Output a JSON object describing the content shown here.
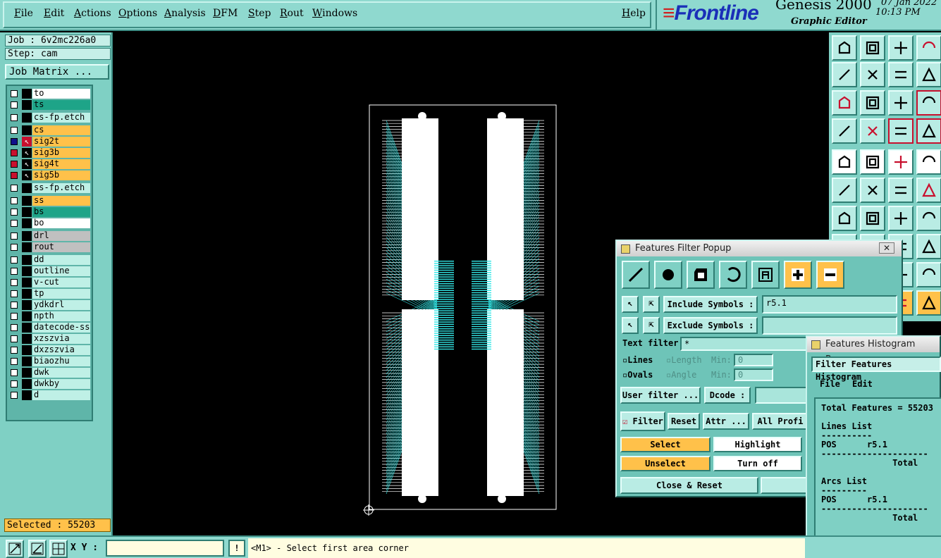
{
  "menu": {
    "items": [
      "File",
      "Edit",
      "Actions",
      "Options",
      "Analysis",
      "DFM",
      "Step",
      "Rout",
      "Windows"
    ],
    "help": "Help"
  },
  "brand": {
    "logo": "Frontline",
    "title": "Genesis 2000",
    "subtitle": "Graphic Editor",
    "date": "07 Jan 2022",
    "time": "10:13 PM"
  },
  "left": {
    "job": "Job : 6v2mc226a0",
    "step": "Step: cam",
    "job_matrix": "Job Matrix ...",
    "selected": "Selected : 55203",
    "layers": [
      {
        "name": "to",
        "color": "white",
        "chk": "white",
        "icon": false
      },
      {
        "name": "ts",
        "color": "green",
        "chk": "white",
        "icon": false
      },
      {
        "name": "cs-fp.etch",
        "color": "plain",
        "chk": "white",
        "icon": false
      },
      {
        "name": "cs",
        "color": "orange",
        "chk": "white",
        "icon": false
      },
      {
        "name": "sig2t",
        "color": "orange",
        "chk": "blue",
        "icon": true
      },
      {
        "name": "sig3b",
        "color": "orange",
        "chk": "red",
        "icon": true
      },
      {
        "name": "sig4t",
        "color": "orange",
        "chk": "red",
        "icon": true
      },
      {
        "name": "sig5b",
        "color": "orange",
        "chk": "red",
        "icon": true
      },
      {
        "name": "ss-fp.etch",
        "color": "plain",
        "chk": "white",
        "icon": false
      },
      {
        "name": "ss",
        "color": "orange",
        "chk": "white",
        "icon": false
      },
      {
        "name": "bs",
        "color": "green",
        "chk": "white",
        "icon": false
      },
      {
        "name": "bo",
        "color": "white",
        "chk": "white",
        "icon": false
      },
      {
        "name": "drl",
        "color": "grey",
        "chk": "white",
        "icon": false
      },
      {
        "name": "rout",
        "color": "grey",
        "chk": "white",
        "icon": false
      },
      {
        "name": "dd",
        "color": "plain",
        "chk": "white",
        "icon": false
      },
      {
        "name": "outline",
        "color": "plain",
        "chk": "white",
        "icon": false
      },
      {
        "name": "v-cut",
        "color": "plain",
        "chk": "white",
        "icon": false
      },
      {
        "name": "tp",
        "color": "plain",
        "chk": "white",
        "icon": false
      },
      {
        "name": "ydkdrl",
        "color": "plain",
        "chk": "white",
        "icon": false
      },
      {
        "name": "npth",
        "color": "plain",
        "chk": "white",
        "icon": false
      },
      {
        "name": "datecode-ss",
        "color": "plain",
        "chk": "white",
        "icon": false
      },
      {
        "name": "xzszvia",
        "color": "plain",
        "chk": "white",
        "icon": false
      },
      {
        "name": "dxzszvia",
        "color": "plain",
        "chk": "white",
        "icon": false
      },
      {
        "name": "biaozhu",
        "color": "plain",
        "chk": "white",
        "icon": false
      },
      {
        "name": "dwk",
        "color": "plain",
        "chk": "white",
        "icon": false
      },
      {
        "name": "dwkby",
        "color": "plain",
        "chk": "white",
        "icon": false
      },
      {
        "name": "d",
        "color": "plain",
        "chk": "white",
        "icon": false
      }
    ]
  },
  "bottom": {
    "xy_label": "X Y :",
    "xy_value": "",
    "status": "<M1> - Select first area corner"
  },
  "filter_popup": {
    "title": "Features Filter Popup",
    "include_label": "Include Symbols :",
    "include_value": "r5.1",
    "exclude_label": "Exclude Symbols :",
    "exclude_value": "",
    "text_filter_label": "Text filter",
    "text_filter_value": "*",
    "lines": "Lines",
    "ovals": "Ovals",
    "length": "Length",
    "angle": "Angle",
    "min": "Min:",
    "min_value": "0",
    "user_filter": "User filter ...",
    "dcode": "Dcode :",
    "filter": "Filter",
    "reset": "Reset",
    "attr": "Attr ...",
    "all_profile": "All Profi",
    "select": "Select",
    "highlight": "Highlight",
    "unselect": "Unselect",
    "turn_off": "Turn off",
    "close_reset": "Close & Reset"
  },
  "histogram_popup": {
    "title": "Features Histogram Popup",
    "header": "Filter Features Histogram",
    "menu_file": "File",
    "menu_edit": "Edit",
    "lines": [
      "Total Features = 55203",
      "",
      "Lines List",
      "----------",
      "POS      r5.1",
      "---------------------",
      "              Total",
      "",
      "Arcs List",
      "---------",
      "POS      r5.1",
      "---------------------",
      "              Total"
    ]
  },
  "colors": {
    "panel": "#7fd0c4",
    "trace": "#33e6e6",
    "orange": "#ffc14a"
  },
  "icons": [
    "open-icon",
    "save-icon",
    "home-icon",
    "step-icon",
    "zoom-icon",
    "pan-icon",
    "undo-icon",
    "scale-icon",
    "help-icon",
    "tools-icon",
    "net-icon",
    "pad-icon",
    "snap-icon",
    "measure-icon",
    "ruler-icon",
    "circle-icon",
    "network-icon",
    "cross-icon",
    "connect-icon",
    "line-icon",
    "arc-icon",
    "route-icon"
  ]
}
